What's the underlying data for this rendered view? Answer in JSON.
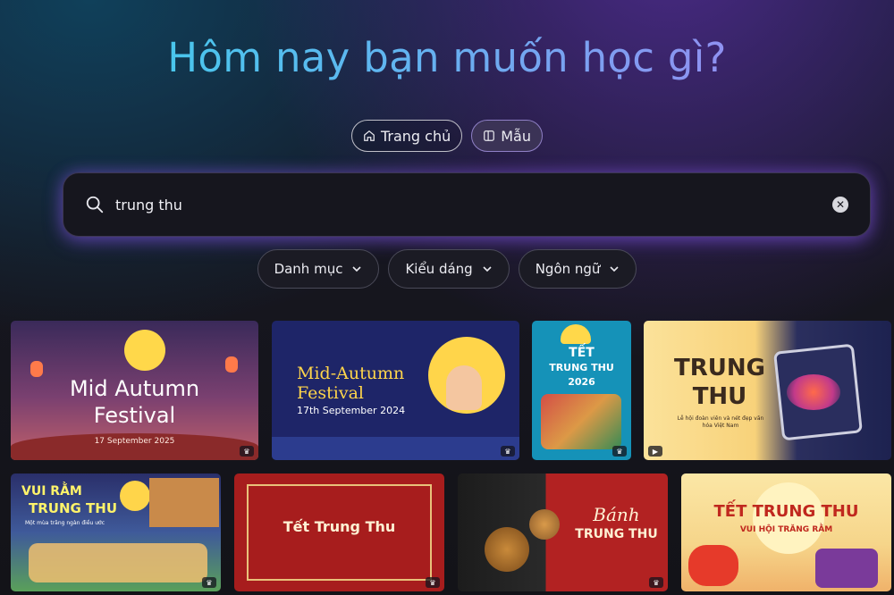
{
  "headline": "Hôm nay bạn muốn học gì?",
  "modes": [
    {
      "label": "Trang chủ",
      "icon": "home-icon",
      "active": false
    },
    {
      "label": "Mẫu",
      "icon": "template-icon",
      "active": true
    }
  ],
  "search": {
    "value": "trung thu",
    "placeholder": ""
  },
  "filters": [
    {
      "label": "Danh mục"
    },
    {
      "label": "Kiểu dáng"
    },
    {
      "label": "Ngôn ngữ"
    }
  ],
  "cards": [
    {
      "title": "Mid Autumn",
      "title2": "Festival",
      "date": "17 September 2025"
    },
    {
      "title": "Mid-Autumn",
      "title2": "Festival",
      "date": "17th September 2024"
    },
    {
      "title": "TẾT",
      "title2": "TRUNG THU",
      "year": "2026"
    },
    {
      "title": "TRUNG",
      "title2": "THU",
      "subtitle": "Lễ hội đoàn viên và nét đẹp văn hóa Việt Nam"
    },
    {
      "title": "VUI RẰM",
      "title2": "TRUNG THU",
      "subtitle": "Một mùa trăng ngàn điều ước"
    },
    {
      "title": "Tết Trung Thu"
    },
    {
      "title": "Bánh",
      "title2": "TRUNG THU"
    },
    {
      "title": "TẾT TRUNG THU",
      "subtitle": "VUI HỘI TRĂNG RẰM"
    }
  ],
  "colors": {
    "accent": "#8a5ce6",
    "headline_start": "#37d3ea",
    "headline_end": "#a77ff2"
  }
}
